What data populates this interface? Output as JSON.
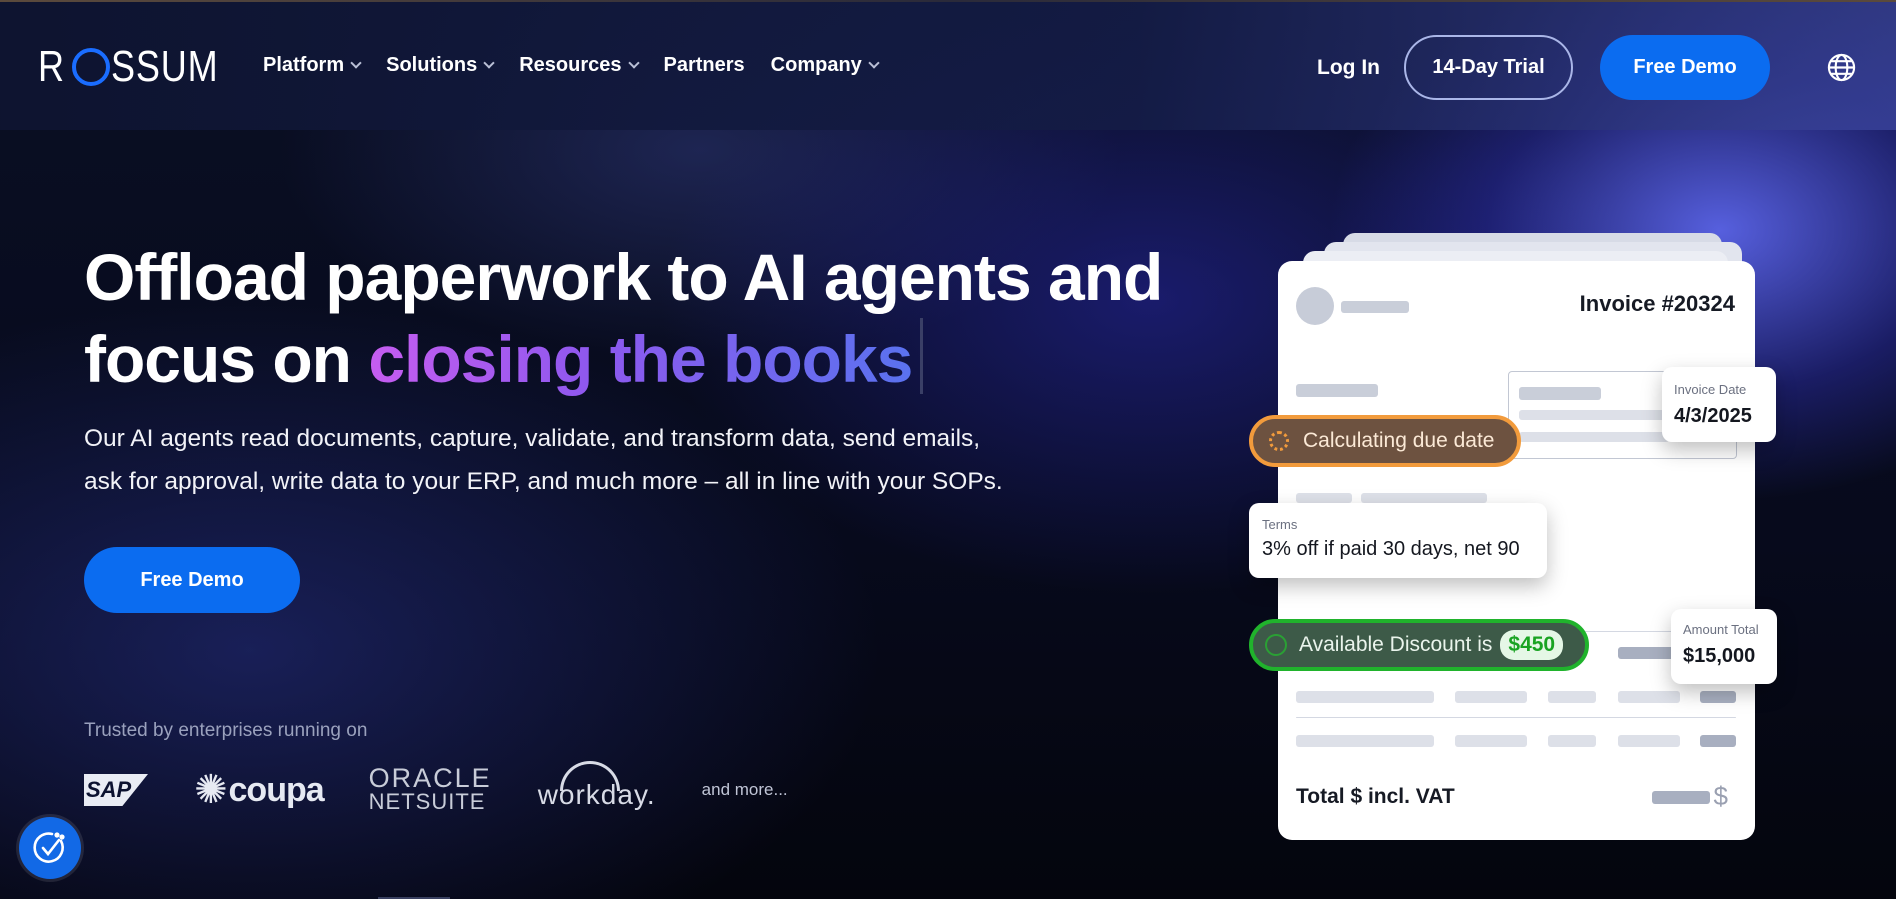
{
  "nav": {
    "logo": "ROSSUM",
    "menu": [
      {
        "label": "Platform",
        "dropdown": true
      },
      {
        "label": "Solutions",
        "dropdown": true
      },
      {
        "label": "Resources",
        "dropdown": true
      },
      {
        "label": "Partners",
        "dropdown": false
      },
      {
        "label": "Company",
        "dropdown": true
      }
    ],
    "login": "Log In",
    "trial": "14-Day Trial",
    "demo": "Free Demo",
    "language_icon": "globe-icon"
  },
  "hero": {
    "title_line1": "Offload paperwork to AI agents and",
    "title_line2_prefix": "focus on ",
    "title_highlight": "closing the books",
    "subtitle_line1": "Our AI agents read documents, capture, validate, and transform data, send emails,",
    "subtitle_line2": "ask for approval, write data to your ERP, and much more – all in line with your SOPs.",
    "cta": "Free Demo"
  },
  "trusted": {
    "label": "Trusted by enterprises running on",
    "logos": {
      "sap": "SAP",
      "coupa": "coupa",
      "oracle_line1": "ORACLE",
      "oracle_line2": "NETSUITE",
      "workday": "workday."
    },
    "more": "and more..."
  },
  "invoice": {
    "title": "Invoice #20324",
    "invoice_date_label": "Invoice Date",
    "invoice_date_value": "4/3/2025",
    "calc_pill": "Calculating due date",
    "terms_label": "Terms",
    "terms_value": "3% off if paid 30 days, net 90",
    "discount_prefix": "Available Discount is",
    "discount_amount": "$450",
    "amount_label": "Amount Total",
    "amount_value": "$15,000",
    "total_label": "Total $ incl. VAT",
    "currency_symbol": "$"
  },
  "colors": {
    "accent_blue": "#0b6cf0",
    "orange": "#f29b3c",
    "green": "#20b32c"
  },
  "accessibility_icon": "accessibility-icon"
}
